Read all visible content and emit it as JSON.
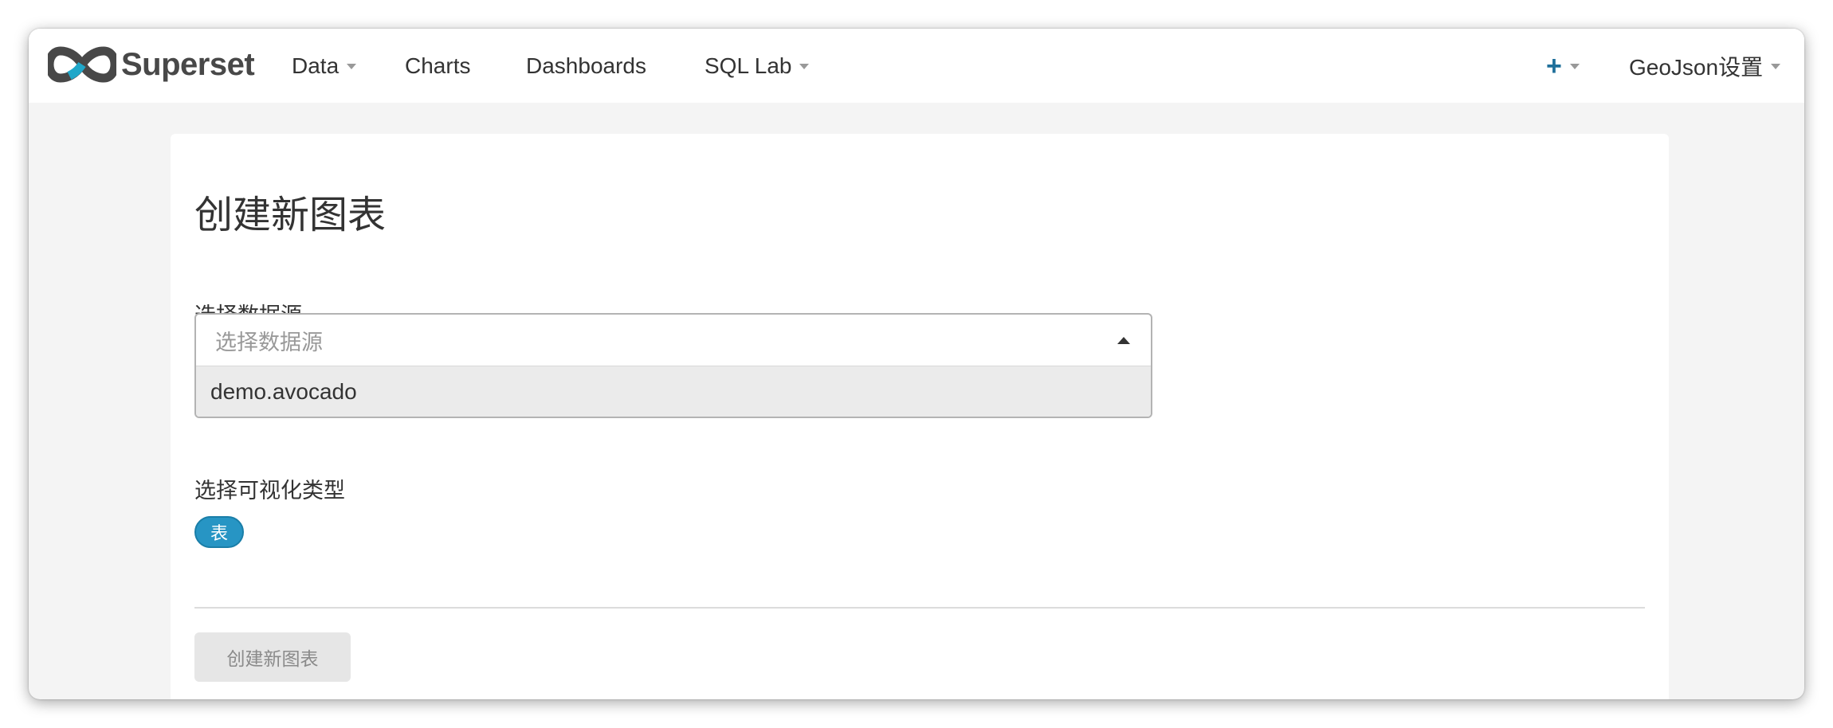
{
  "navbar": {
    "brand": "Superset",
    "items": [
      {
        "label": "Data",
        "has_dropdown": true
      },
      {
        "label": "Charts",
        "has_dropdown": false
      },
      {
        "label": "Dashboards",
        "has_dropdown": false
      },
      {
        "label": "SQL Lab",
        "has_dropdown": true
      }
    ],
    "add_icon": "+",
    "settings_label": "GeoJson设置"
  },
  "page": {
    "title": "创建新图表",
    "datasource_label": "选择数据源",
    "datasource_placeholder": "选择数据源",
    "datasource_options": [
      "demo.avocado"
    ],
    "viz_label": "选择可视化类型",
    "viz_selected": "表",
    "create_button": "创建新图表"
  },
  "icons": {
    "logo": "superset-logo-icon",
    "dropdown": "caret-down-icon",
    "select_arrow": "caret-up-icon",
    "add": "plus-icon"
  },
  "colors": {
    "primary": "#2795c4",
    "logo_blue": "#20a7c9",
    "add_icon": "#1f6f9a",
    "text": "#333333",
    "muted": "#999999"
  }
}
